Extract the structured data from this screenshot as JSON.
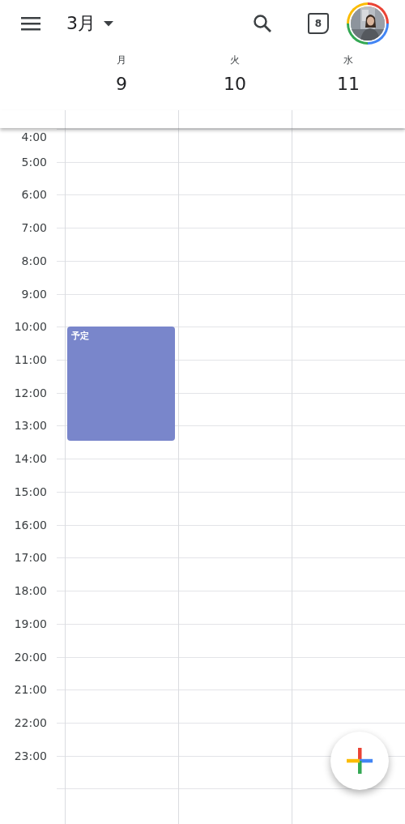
{
  "header": {
    "month": "3月",
    "today_badge": "8"
  },
  "days": [
    {
      "weekday": "月",
      "date": "9",
      "events": [
        {
          "title": "予定",
          "color": "#7986cb"
        }
      ]
    },
    {
      "weekday": "火",
      "date": "10"
    },
    {
      "weekday": "水",
      "date": "11"
    }
  ],
  "hours": [
    "4:00",
    "5:00",
    "6:00",
    "7:00",
    "8:00",
    "9:00",
    "10:00",
    "11:00",
    "12:00",
    "13:00",
    "14:00",
    "15:00",
    "16:00",
    "17:00",
    "18:00",
    "19:00",
    "20:00",
    "21:00",
    "22:00",
    "23:00"
  ]
}
